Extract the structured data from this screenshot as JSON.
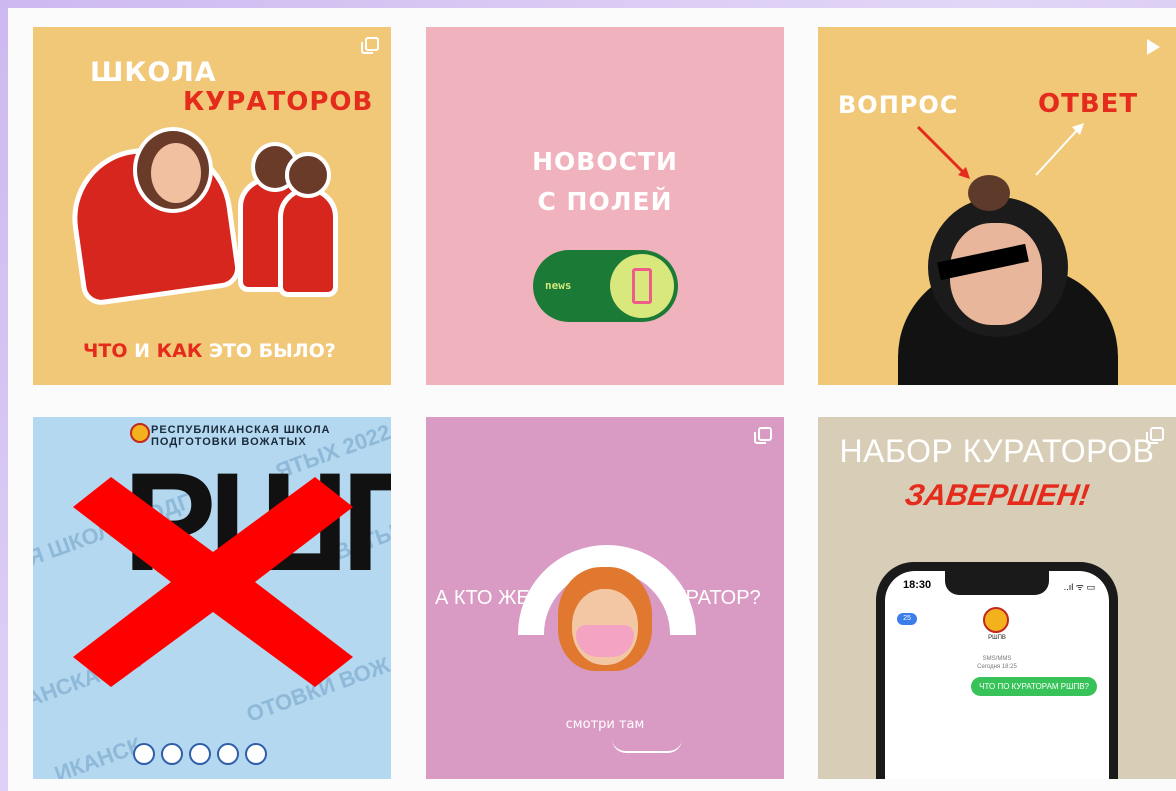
{
  "feed": {
    "posts": [
      {
        "indicator": "multi-icon",
        "line1": "ШКОЛА",
        "line2": "КУРАТОРОВ",
        "footer_red": "ЧТО",
        "footer_white": " И ",
        "footer_red2": "КАК",
        "footer_white2": " ЭТО БЫЛО?"
      },
      {
        "indicator": "none",
        "line1": "НОВОСТИ",
        "line2": "С ПОЛЕЙ",
        "toggle_label": "news"
      },
      {
        "indicator": "play-icon",
        "left_word": "ВОПРОС",
        "right_word": "ОТВЕТ"
      },
      {
        "indicator": "none",
        "header_line1": "РЕСПУБЛИКАНСКАЯ ШКОЛА",
        "header_line2": "ПОДГОТОВКИ ВОЖАТЫХ",
        "big": "РШПВ",
        "bg_1": "ЯТЫХ 2022",
        "bg_2": "Я ШКОЛА ПОДГ",
        "bg_3": "ВАТЫХ",
        "bg_4": "АНСКАЯ Ш",
        "bg_5": "ОТОВКИ ВОЖ",
        "bg_6": "ИКАНСК"
      },
      {
        "indicator": "multi-icon",
        "left": "А КТО ЖЕ",
        "right": "КУРАТОР?",
        "look": "смотри там"
      },
      {
        "indicator": "multi-icon",
        "title": "НАБОР КУРАТОРОВ",
        "subtitle": "ЗАВЕРШЕН!",
        "phone_time": "18:30",
        "phone_status": "..ıl ᯤ ▭",
        "back_count": "25",
        "contact": "РШПВ",
        "sms_line1": "SMS/MMS",
        "sms_line2": "Сегодня 18:25",
        "message": "ЧТО ПО КУРАТОРАМ РШПВ?"
      }
    ]
  },
  "colors": {
    "yellow": "#f1c877",
    "pink": "#f0b3bd",
    "blue": "#b3d8ef",
    "mauve": "#d99bc3",
    "beige": "#d8ceb7",
    "red": "#e42b1c",
    "x_mark": "#ff0000"
  }
}
